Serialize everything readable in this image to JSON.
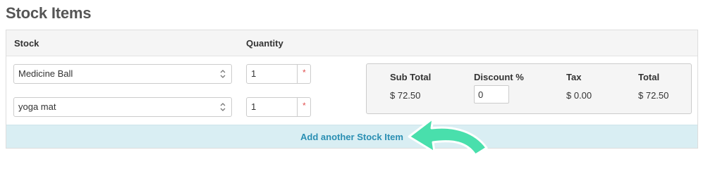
{
  "section": {
    "title": "Stock Items"
  },
  "table": {
    "columns": {
      "stock": "Stock",
      "quantity": "Quantity"
    },
    "rows": [
      {
        "stock": "Medicine Ball",
        "quantity": "1",
        "required_mark": "*"
      },
      {
        "stock": "yoga mat",
        "quantity": "1",
        "required_mark": "*"
      }
    ]
  },
  "totals": {
    "labels": {
      "sub_total": "Sub Total",
      "discount": "Discount %",
      "tax": "Tax",
      "total": "Total"
    },
    "values": {
      "sub_total": "$ 72.50",
      "discount": "0",
      "tax": "$ 0.00",
      "total": "$ 72.50"
    }
  },
  "actions": {
    "add_stock_item": "Add another Stock Item"
  },
  "colors": {
    "link": "#2a8fb3",
    "add_bar_bg": "#d9eef3",
    "arrow": "#49dfac",
    "required": "#e05050"
  },
  "icons": {
    "select_chevron": "chevron-updown-icon",
    "pointer_arrow": "curved-arrow-icon"
  }
}
